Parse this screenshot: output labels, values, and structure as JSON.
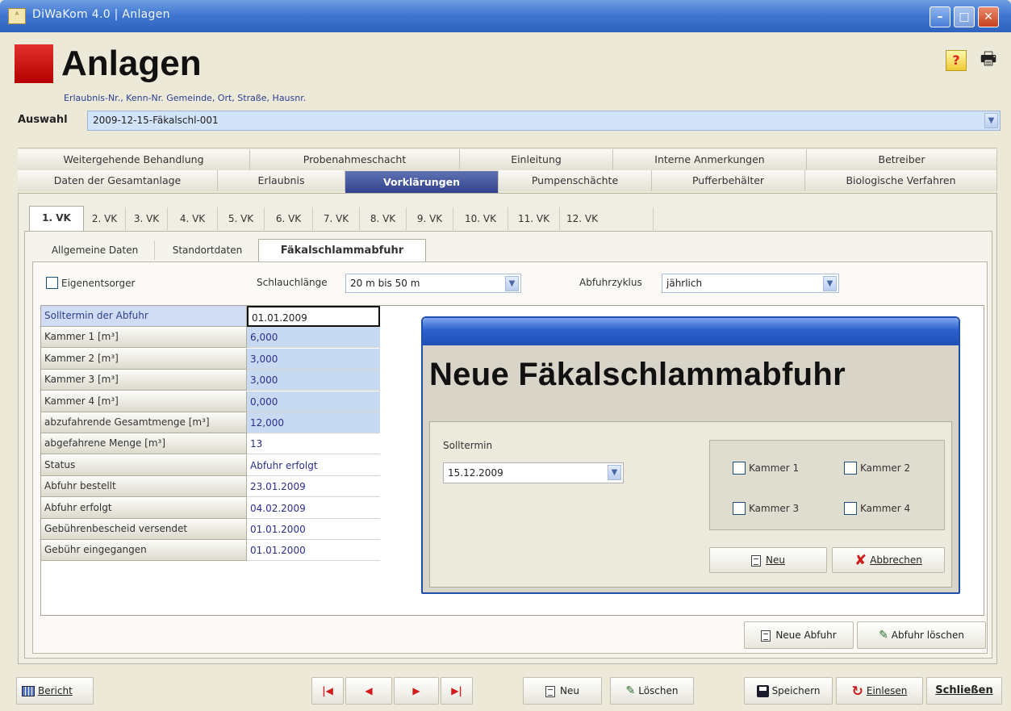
{
  "window": {
    "title": "DiWaKom 4.0  |  Anlagen",
    "minimize": "–",
    "maximize": "□",
    "close": "✕"
  },
  "header": {
    "page_title": "Anlagen",
    "search_hint": "Erlaubnis-Nr., Kenn-Nr. Gemeinde, Ort, Straße, Hausnr.",
    "auswahl_label": "Auswahl",
    "auswahl_value": "2009-12-15-Fäkalschl-001",
    "help": "?",
    "print": "🖶"
  },
  "main_tabs_row1": [
    "Weitergehende Behandlung",
    "Probenahmeschacht",
    "Einleitung",
    "Interne Anmerkungen",
    "Betreiber"
  ],
  "main_tabs_row2": [
    "Daten der Gesamtanlage",
    "Erlaubnis",
    "Vorklärungen",
    "Pumpenschächte",
    "Pufferbehälter",
    "Biologische Verfahren"
  ],
  "vk_tabs": [
    "1. VK",
    "2. VK",
    "3. VK",
    "4. VK",
    "5. VK",
    "6. VK",
    "7. VK",
    "8. VK",
    "9. VK",
    "10. VK",
    "11. VK",
    "12. VK"
  ],
  "sub_tabs": [
    "Allgemeine Daten",
    "Standortdaten",
    "Fäkalschlammabfuhr"
  ],
  "form": {
    "eigenentsorger_label": "Eigenentsorger",
    "schlauch_label": "Schlauchlänge",
    "schlauch_value": "20 m bis 50 m",
    "zyklus_label": "Abfuhrzyklus",
    "zyklus_value": "jährlich"
  },
  "grid": [
    {
      "key": "Solltermin der Abfuhr",
      "value": "01.01.2009"
    },
    {
      "key": "Kammer 1 [m³]",
      "value": "6,000"
    },
    {
      "key": "Kammer 2 [m³]",
      "value": "3,000"
    },
    {
      "key": "Kammer 3 [m³]",
      "value": "3,000"
    },
    {
      "key": "Kammer 4 [m³]",
      "value": "0,000"
    },
    {
      "key": "abzufahrende Gesamtmenge [m³]",
      "value": "12,000"
    },
    {
      "key": "abgefahrene Menge [m³]",
      "value": "13"
    },
    {
      "key": "Status",
      "value": "Abfuhr erfolgt"
    },
    {
      "key": "Abfuhr bestellt",
      "value": "23.01.2009"
    },
    {
      "key": "Abfuhr erfolgt",
      "value": "04.02.2009"
    },
    {
      "key": "Gebührenbescheid versendet",
      "value": "01.01.2000"
    },
    {
      "key": "Gebühr eingegangen",
      "value": "01.01.2000"
    }
  ],
  "dialog": {
    "title": "Neue Fäkalschlammabfuhr",
    "solltermin_label": "Solltermin",
    "solltermin_value": "15.12.2009",
    "kammer": [
      "Kammer 1",
      "Kammer 2",
      "Kammer 3",
      "Kammer 4"
    ],
    "neu_button": "Neu",
    "abbrechen_button": "Abbrechen"
  },
  "panel_buttons": {
    "neue_abfuhr": "Neue Abfuhr",
    "abfuhr_loeschen": "Abfuhr löschen"
  },
  "bottom": {
    "bericht": "Bericht",
    "neu": "Neu",
    "loeschen": "Löschen",
    "speichern": "Speichern",
    "einlesen": "Einlesen",
    "schliessen": "Schließen"
  }
}
